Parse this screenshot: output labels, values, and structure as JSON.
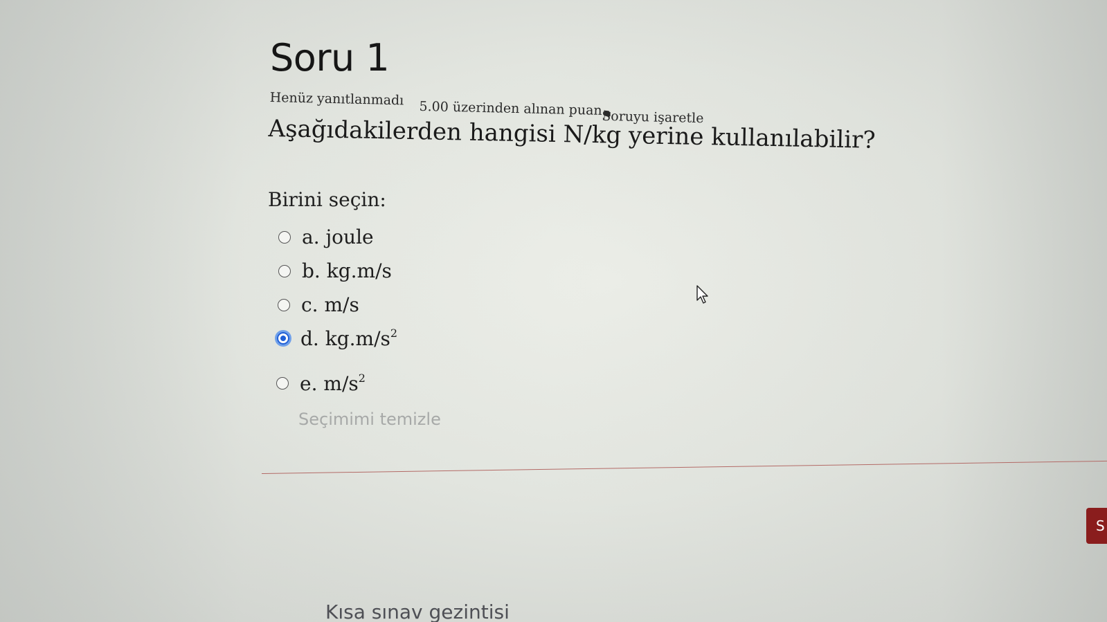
{
  "question": {
    "title": "Soru 1",
    "state": "Henüz yanıtlanmadı",
    "grade": "5.00 üzerinden alınan puan",
    "flag_label": "Soruyu işaretle",
    "text": "Aşağıdakilerden hangisi N/kg yerine kullanılabilir?"
  },
  "answer": {
    "prompt": "Birini seçin:",
    "options": [
      {
        "letter": "a.",
        "text": "joule",
        "superscript": "",
        "checked": false
      },
      {
        "letter": "b.",
        "text": "kg.m/s",
        "superscript": "",
        "checked": false
      },
      {
        "letter": "c.",
        "text": "m/s",
        "superscript": "",
        "checked": false
      },
      {
        "letter": "d.",
        "text": "kg.m/s",
        "superscript": "2",
        "checked": true
      },
      {
        "letter": "e.",
        "text": "m/s",
        "superscript": "2",
        "checked": false
      }
    ],
    "clear_label": "Seçimimi temizle"
  },
  "navigation": {
    "next_button_label": "S",
    "quiz_navigation_title": "Kısa sınav gezintisi"
  },
  "icons": {
    "flag": "flag-icon",
    "radio": "radio-button",
    "cursor": "mouse-cursor-icon"
  },
  "colors": {
    "accent": "#1f5fd6",
    "button": "#8a1d1d",
    "divider": "#b36a66",
    "muted_link": "#a7a9a8"
  }
}
